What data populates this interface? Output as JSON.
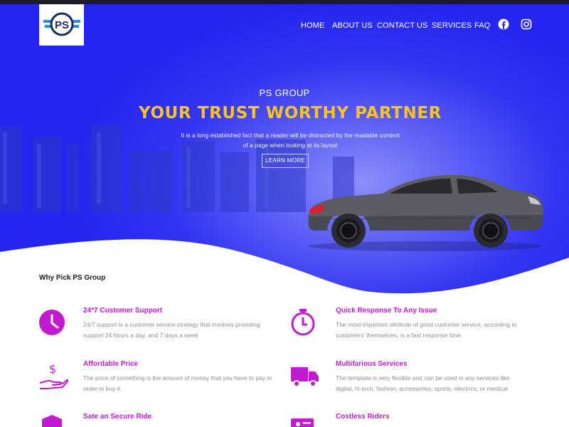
{
  "brand": {
    "logo_text": "PS"
  },
  "nav": {
    "items": [
      {
        "label": "HOME"
      },
      {
        "label": "ABOUT US"
      },
      {
        "label": "CONTACT US"
      },
      {
        "label": "SERVICES"
      },
      {
        "label": "FAQ"
      }
    ],
    "social": [
      "facebook-icon",
      "instagram-icon"
    ]
  },
  "hero": {
    "subtitle": "PS GROUP",
    "title": "YOUR TRUST WORTHY PARTNER",
    "description": "It is a long established fact that a reader will be distracted by the readable content of a page when looking at its layout",
    "button_label": "LEARN MORE"
  },
  "features_section": {
    "title": "Why Pick PS Group",
    "items": [
      {
        "icon": "clock-icon",
        "title": "24*7 Customer Support",
        "desc": "24/7 support is a customer service strategy that involves providing support 24 hours a day, and 7 days a week"
      },
      {
        "icon": "stopwatch-icon",
        "title": "Quick Response To Any Issue",
        "desc": "The most important attribute of good customer service, according to customers' themselves, is a fast response time."
      },
      {
        "icon": "money-hand-icon",
        "title": "Affordable Price",
        "desc": "The price of something is the amount of money that you have to pay in order to buy it."
      },
      {
        "icon": "truck-icon",
        "title": "Multifarious Services",
        "desc": "The template is very flexible and can be used in any services like digital, hi-tech, fashion, accessories, sports, electrics, or medical"
      },
      {
        "icon": "shield-icon",
        "title": "Sate an Secure Ride",
        "desc": ""
      },
      {
        "icon": "id-card-icon",
        "title": "Costless Riders",
        "desc": ""
      }
    ]
  },
  "colors": {
    "hero_blue": "#2425ee",
    "accent_yellow": "#f7c51b",
    "accent_magenta": "#c21ad0"
  }
}
